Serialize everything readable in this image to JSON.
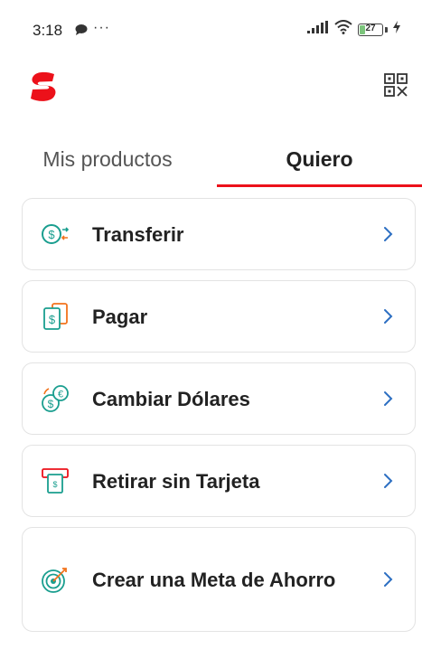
{
  "status_bar": {
    "time": "3:18",
    "dots": "···",
    "battery_level": "27",
    "battery_fraction": 0.27
  },
  "header": {
    "logo_icon": "scotiabank-logo-icon",
    "qr_icon": "qr-code-icon",
    "brand_color": "#ec111a"
  },
  "tabs": [
    {
      "label": "Mis productos",
      "selected": false
    },
    {
      "label": "Quiero",
      "selected": true
    }
  ],
  "actions": [
    {
      "label": "Transferir",
      "icon": "transfer-money-icon"
    },
    {
      "label": "Pagar",
      "icon": "pay-bill-icon"
    },
    {
      "label": "Cambiar Dólares",
      "icon": "currency-exchange-icon"
    },
    {
      "label": "Retirar sin Tarjeta",
      "icon": "cardless-withdrawal-icon"
    },
    {
      "label": "Crear una Meta de Ahorro",
      "icon": "savings-goal-icon"
    }
  ],
  "colors": {
    "accent": "#ec111a",
    "icon_teal": "#1a9e8f",
    "icon_orange": "#f2731c",
    "chevron_blue": "#2d6fc2"
  }
}
